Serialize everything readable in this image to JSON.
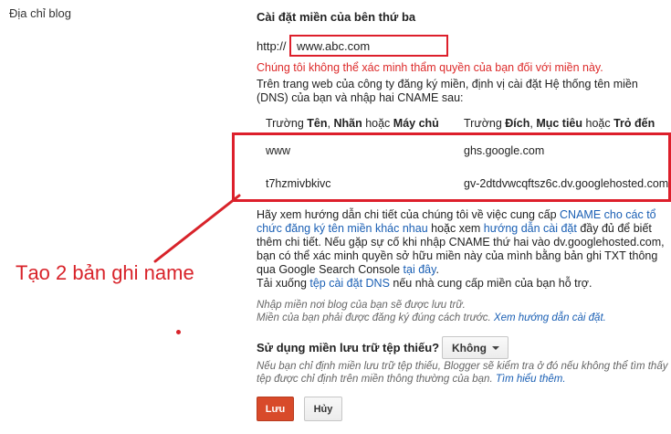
{
  "sidebar": {
    "label": "Địa chỉ blog"
  },
  "section": {
    "title": "Cài đặt miền của bên thứ ba"
  },
  "url": {
    "prefix": "http://",
    "value": "www.abc.com"
  },
  "error": "Chúng tôi không thể xác minh thẩm quyền của bạn đối với miền này.",
  "instructions": "Trên trang web của công ty đăng ký miền, định vị cài đặt Hệ thống tên miền (DNS) của bạn và nhập hai CNAME sau:",
  "table": {
    "header_name": {
      "a": "Trường ",
      "b": "Tên",
      "c": ", ",
      "d": "Nhãn",
      "e": " hoặc ",
      "f": "Máy chủ"
    },
    "header_dest": {
      "a": "Trường ",
      "b": "Đích",
      "c": ", ",
      "d": "Mục tiêu",
      "e": " hoặc ",
      "f": "Trỏ đến"
    },
    "rows": [
      {
        "name": "www",
        "dest": "ghs.google.com"
      },
      {
        "name": "t7hzmivbkivc",
        "dest": "gv-2dtdvwcqftsz6c.dv.googlehosted.com"
      }
    ]
  },
  "help": {
    "t1": "Hãy xem hướng dẫn chi tiết của chúng tôi về việc cung cấp ",
    "l1": "CNAME cho các tổ chức đăng ký tên miền khác nhau",
    "t2": " hoặc xem ",
    "l2": "hướng dẫn cài đặt",
    "t3": " đầy đủ để biết thêm chi tiết. Nếu gặp sự cố khi nhập CNAME thứ hai vào dv.googlehosted.com, bạn có thể xác minh quyền sở hữu miền này của mình bằng bản ghi TXT thông qua Google Search Console ",
    "l3": "tại đây",
    "t4": ".",
    "t5": "Tải xuống ",
    "l4": "tệp cài đặt DNS",
    "t6": " nếu nhà cung cấp miền của bạn hỗ trợ."
  },
  "note1": {
    "line1": "Nhập miền nơi blog của bạn sẽ được lưu trữ.",
    "line2": "Miền của bạn phải được đăng ký đúng cách trước. ",
    "link": "Xem hướng dẫn cài đặt."
  },
  "annotation": "Tạo 2 bản ghi name",
  "fallback": {
    "question": "Sử dụng miền lưu trữ tệp thiếu?",
    "selected": "Không"
  },
  "note2": {
    "text": "Nếu bạn chỉ định miền lưu trữ tệp thiếu, Blogger sẽ kiểm tra ở đó nếu không thể tìm thấy tệp được chỉ định trên miền thông thường của bạn. ",
    "link": "Tìm hiểu thêm."
  },
  "buttons": {
    "save": "Lưu",
    "cancel": "Hủy"
  },
  "colors": {
    "accent_red": "#dd1f2b",
    "link_blue": "#1a5fb4",
    "save_orange": "#d84a2a"
  }
}
